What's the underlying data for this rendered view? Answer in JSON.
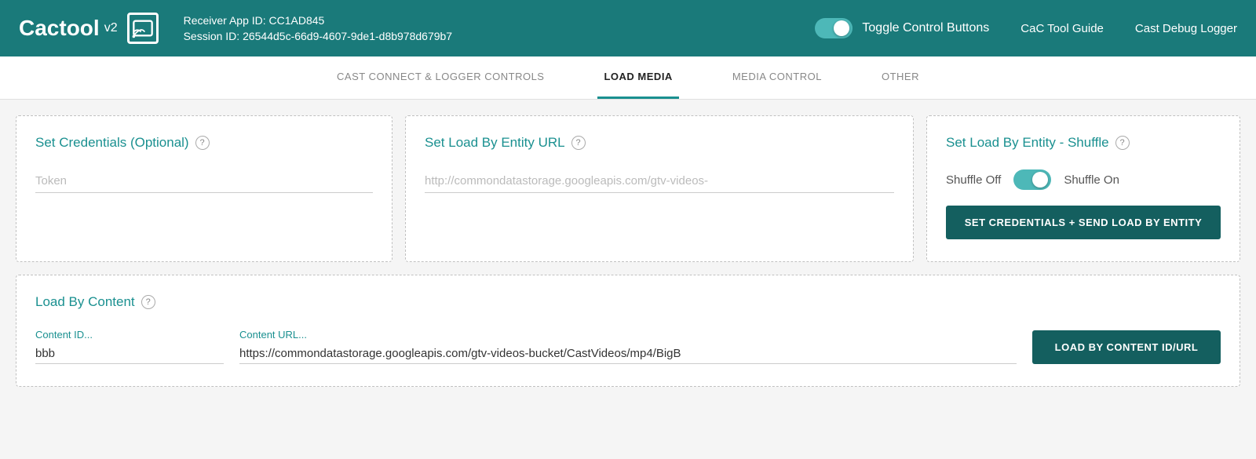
{
  "header": {
    "logo_text": "Cactool",
    "logo_version": "v2",
    "receiver_app_label": "Receiver App ID: CC1AD845",
    "session_id_label": "Session ID: 26544d5c-66d9-4607-9de1-d8b978d679b7",
    "toggle_label": "Toggle Control Buttons",
    "nav_link_guide": "CaC Tool Guide",
    "nav_link_logger": "Cast Debug Logger"
  },
  "tabs": [
    {
      "id": "cast-connect",
      "label": "CAST CONNECT & LOGGER CONTROLS",
      "active": false
    },
    {
      "id": "load-media",
      "label": "LOAD MEDIA",
      "active": true
    },
    {
      "id": "media-control",
      "label": "MEDIA CONTROL",
      "active": false
    },
    {
      "id": "other",
      "label": "OTHER",
      "active": false
    }
  ],
  "cards": {
    "credentials": {
      "title": "Set Credentials (Optional)",
      "help_icon": "?",
      "token_placeholder": "Token"
    },
    "entity_url": {
      "title": "Set Load By Entity URL",
      "help_icon": "?",
      "url_placeholder": "http://commondatastorage.googleapis.com/gtv-videos-"
    },
    "shuffle": {
      "title": "Set Load By Entity - Shuffle",
      "help_icon": "?",
      "shuffle_off_label": "Shuffle Off",
      "shuffle_on_label": "Shuffle On",
      "button_label": "SET CREDENTIALS + SEND LOAD BY ENTITY"
    },
    "load_content": {
      "title": "Load By Content",
      "help_icon": "?",
      "content_id_label": "Content ID...",
      "content_id_value": "bbb",
      "content_url_label": "Content URL...",
      "content_url_value": "https://commondatastorage.googleapis.com/gtv-videos-bucket/CastVideos/mp4/BigB",
      "button_label": "LOAD BY CONTENT ID/URL"
    }
  },
  "colors": {
    "teal_dark": "#1a7a7a",
    "teal_medium": "#1a9090",
    "teal_button": "#145f5f",
    "toggle_bg": "#4db8b8"
  }
}
